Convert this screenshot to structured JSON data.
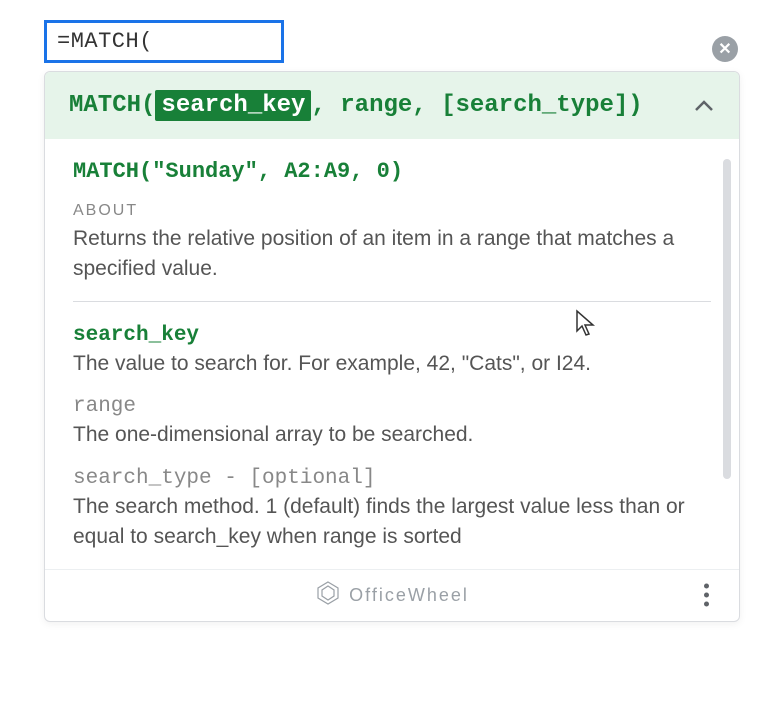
{
  "formula_input": "=MATCH(",
  "signature": {
    "fn": "MATCH(",
    "active_arg": "search_key",
    "rest": ", range, [search_type])"
  },
  "example": "MATCH(\"Sunday\", A2:A9, 0)",
  "about_label": "ABOUT",
  "about_text": "Returns the relative position of an item in a range that matches a specified value.",
  "params": [
    {
      "name": "search_key",
      "desc": "The value to search for. For example, 42, \"Cats\", or I24.",
      "active": true
    },
    {
      "name": "range",
      "desc": "The one-dimensional array to be searched.",
      "active": false
    },
    {
      "name": "search_type - [optional]",
      "desc": "The search method. 1 (default) finds the largest value less than or equal to search_key when range is sorted",
      "active": false
    }
  ],
  "brand": "OfficeWheel"
}
